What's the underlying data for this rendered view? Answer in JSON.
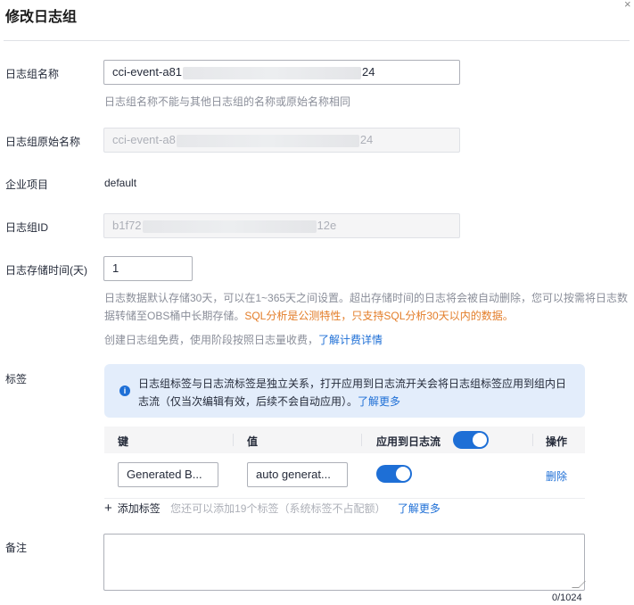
{
  "dialog": {
    "title": "修改日志组",
    "close_glyph": "×"
  },
  "form": {
    "log_group_name": {
      "label": "日志组名称",
      "value_prefix": "cci-event-a81",
      "value_suffix": "24",
      "hint": "日志组名称不能与其他日志组的名称或原始名称相同"
    },
    "original_name": {
      "label": "日志组原始名称",
      "value_prefix": "cci-event-a8",
      "value_suffix": "24"
    },
    "enterprise_project": {
      "label": "企业项目",
      "value": "default"
    },
    "log_group_id": {
      "label": "日志组ID",
      "value_prefix": "b1f72",
      "value_suffix": "12e"
    },
    "retention": {
      "label": "日志存储时间(天)",
      "value": "1",
      "hint_line1": "日志数据默认存储30天，可以在1~365天之间设置。超出存储时间的日志将会被自动删除，您可以按需将日志数",
      "hint_line2_prefix": "据转储至OBS桶中长期存储。",
      "hint_line2_warn": "SQL分析是公测特性，只支持SQL分析30天以内的数据。",
      "billing_text": "创建日志组免费，使用阶段按照日志量收费，",
      "billing_link": "了解计费详情"
    },
    "tags": {
      "label": "标签",
      "info_text_line1": "日志组标签与日志流标签是独立关系，打开应用到日志流开关会将日志组标签应用到组内日",
      "info_text_line2": "志流（仅当次编辑有效，后续不会自动应用）。",
      "info_link": "了解更多",
      "columns": {
        "key": "键",
        "value": "值",
        "apply": "应用到日志流",
        "operation": "操作"
      },
      "apply_all_on": true,
      "rows": [
        {
          "key": "Generated B...",
          "value": "auto generat...",
          "apply_on": true,
          "delete_label": "删除"
        }
      ],
      "add_label": "添加标签",
      "add_hint": "您还可以添加19个标签（系统标签不占配额）",
      "add_link": "了解更多"
    },
    "remark": {
      "label": "备注",
      "value": "",
      "counter": "0/1024"
    }
  }
}
